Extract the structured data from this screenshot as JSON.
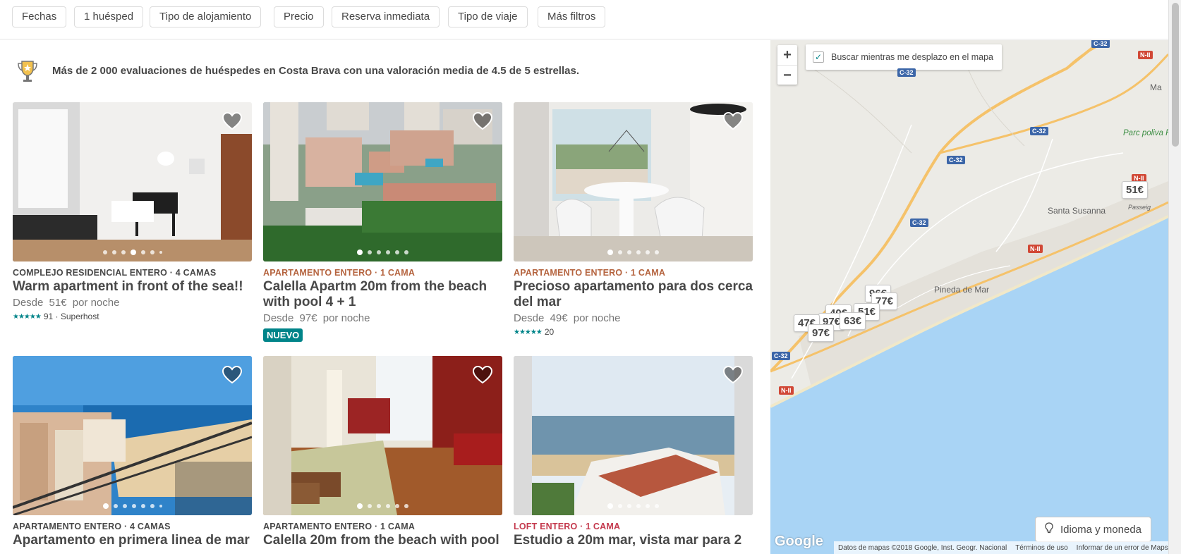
{
  "filters": [
    "Fechas",
    "1 huésped",
    "Tipo de alojamiento",
    "Precio",
    "Reserva inmediata",
    "Tipo de viaje",
    "Más filtros"
  ],
  "banner": {
    "icon": "trophy-icon",
    "text": "Más de 2 000 evaluaciones de huéspedes en Costa Brava con una valoración media de 4.5 de 5 estrellas."
  },
  "listings": [
    {
      "kicker": "COMPLEJO RESIDENCIAL ENTERO · 4 CAMAS",
      "title": "Warm apartment in front of the sea!!",
      "price_prefix": "Desde",
      "price": "51€",
      "price_suffix": "por noche",
      "rating": "91 · Superhost",
      "photo_dots": 7,
      "photo_active": 3
    },
    {
      "kicker": "APARTAMENTO ENTERO · 1 CAMA",
      "title": "Calella Apartm 20m from the beach with pool 4 + 1",
      "price_prefix": "Desde",
      "price": "97€",
      "price_suffix": "por noche",
      "badge": "NUEVO",
      "photo_dots": 6,
      "photo_active": 0
    },
    {
      "kicker": "APARTAMENTO ENTERO · 1 CAMA",
      "title": "Precioso apartamento para dos cerca del mar",
      "price_prefix": "Desde",
      "price": "49€",
      "price_suffix": "por noche",
      "rating": "20",
      "photo_dots": 6,
      "photo_active": 0
    },
    {
      "kicker": "APARTAMENTO ENTERO · 4 CAMAS",
      "title": "Apartamento en primera linea de mar",
      "photo_dots": 7,
      "photo_active": 0
    },
    {
      "kicker": "APARTAMENTO ENTERO · 1 CAMA",
      "title": "Calella 20m from the beach with pool",
      "photo_dots": 6,
      "photo_active": 0
    },
    {
      "kicker": "LOFT ENTERO · 1 CAMA",
      "title": "Estudio a 20m mar, vista mar para 2",
      "photo_dots": 6,
      "photo_active": 0
    }
  ],
  "map": {
    "zoom_in": "+",
    "zoom_out": "−",
    "search_toggle": "Buscar mientras me desplazo en el mapa",
    "search_checked": true,
    "pins": [
      "51€",
      "96€",
      "77€",
      "40€",
      "51€",
      "97€",
      "63€",
      "47€",
      "97€"
    ],
    "places": [
      "Pineda de Mar",
      "Santa Susanna",
      "Parc poliva Francesc M",
      "Ma"
    ],
    "roads": [
      "C-32",
      "C-32",
      "C-32",
      "C-32",
      "C-32",
      "C-32",
      "N-II",
      "N-II",
      "N-II",
      "N-II",
      "Passeig"
    ],
    "language_button": "Idioma y moneda",
    "attribution": {
      "logo": "Google",
      "data": "Datos de mapas ©2018 Google, Inst. Geogr. Nacional",
      "terms": "Términos de uso",
      "report": "Informar de un error de Maps"
    }
  },
  "colors": {
    "accent": "#008489",
    "loft_kicker": "#c4394d",
    "sea": "#a9d4f5",
    "land": "#ecebe6",
    "road_major": "#f5c26a"
  }
}
